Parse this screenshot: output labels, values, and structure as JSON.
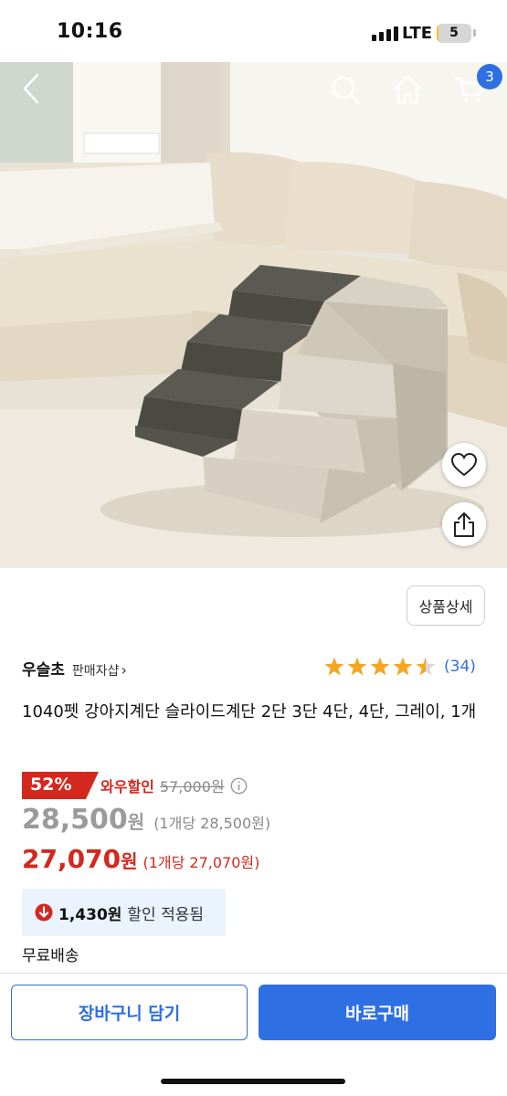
{
  "status_bar": {
    "time": "10:16",
    "network": "LTE",
    "battery_level": "5"
  },
  "header": {
    "cart_count": "3",
    "icons": [
      "back-icon",
      "search-icon",
      "home-icon",
      "cart-icon"
    ]
  },
  "hero_actions": {
    "icons": [
      "heart-icon",
      "share-icon"
    ]
  },
  "detail_button": "상품상세",
  "seller": {
    "name": "우슬초",
    "shop_label": "판매자샵",
    "chevron": "›"
  },
  "rating": {
    "stars": 4.5,
    "count": "(34)"
  },
  "product_title": "1040펫 강아지계단 슬라이드계단 2단 3단 4단, 4단, 그레이, 1개",
  "discount": {
    "percent": "52%",
    "label": "와우할인",
    "original_price": "57,000원"
  },
  "price": {
    "amount": "28,500",
    "currency": "원",
    "unit": "(1개당 28,500원)"
  },
  "wow_price": {
    "amount": "27,070",
    "currency": "원",
    "unit": "(1개당 27,070원)"
  },
  "applied_discount": {
    "amount": "1,430원",
    "text": "할인 적용됨"
  },
  "shipping": "무료배송",
  "buttons": {
    "cart": "장바구니 담기",
    "buy": "바로구매"
  },
  "colors": {
    "accent": "#2f6fe4",
    "sale_red": "#d3281e",
    "star": "#f5a623"
  }
}
